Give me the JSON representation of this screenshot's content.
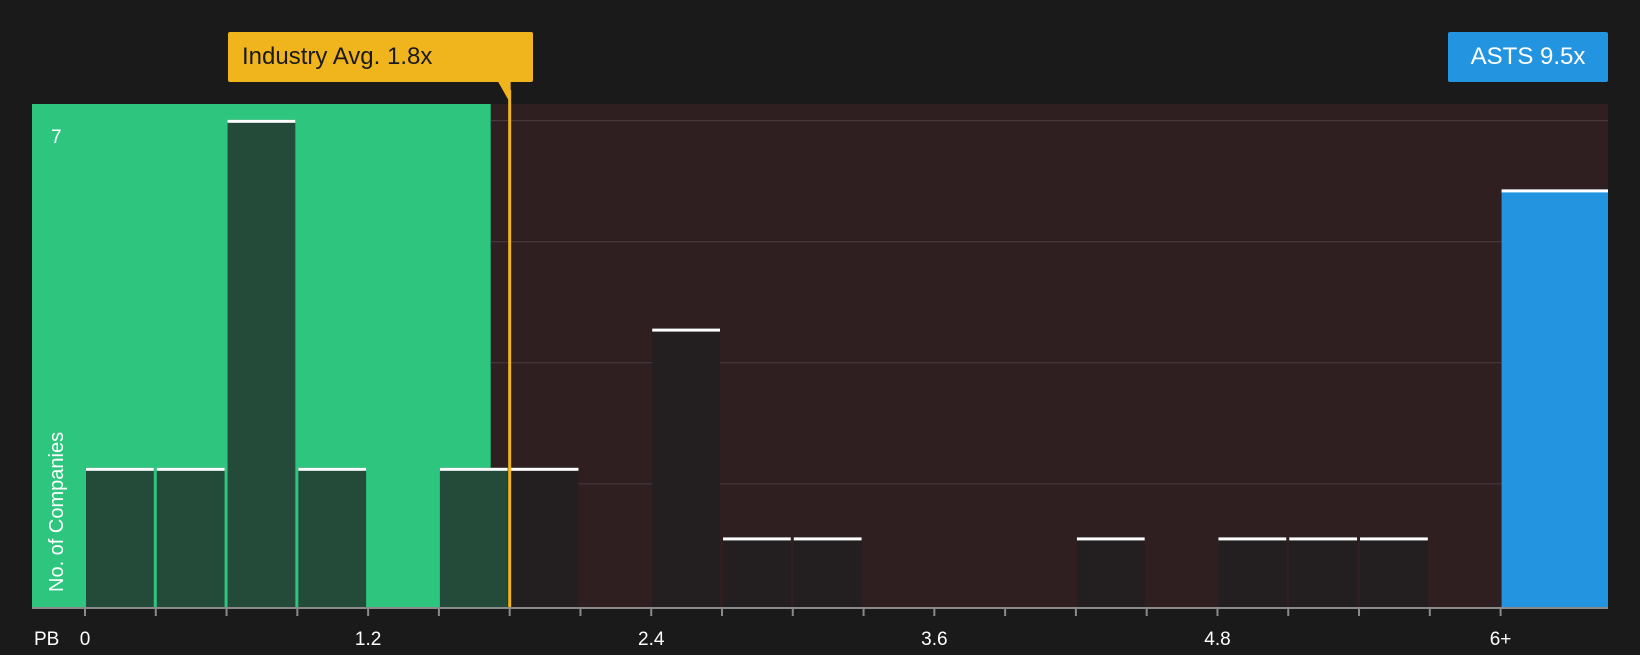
{
  "chart_data": {
    "type": "bar",
    "title": "",
    "xlabel": "PB",
    "ylabel": "No. of Companies",
    "xlim": [
      0,
      6.2
    ],
    "ylim": [
      0,
      7
    ],
    "bin_width": 0.3,
    "x_ticks": [
      {
        "value": 0,
        "label": "0"
      },
      {
        "value": 1.2,
        "label": "1.2"
      },
      {
        "value": 2.4,
        "label": "2.4"
      },
      {
        "value": 3.6,
        "label": "3.6"
      },
      {
        "value": 4.8,
        "label": "4.8"
      },
      {
        "value": 6.0,
        "label": "6+"
      }
    ],
    "y_ticks": [
      {
        "value": 7,
        "label": "7"
      }
    ],
    "bins": [
      {
        "start": 0.0,
        "count": 2
      },
      {
        "start": 0.3,
        "count": 2
      },
      {
        "start": 0.6,
        "count": 7
      },
      {
        "start": 0.9,
        "count": 2
      },
      {
        "start": 1.5,
        "count": 2
      },
      {
        "start": 1.8,
        "count": 2
      },
      {
        "start": 2.4,
        "count": 4
      },
      {
        "start": 2.7,
        "count": 1
      },
      {
        "start": 3.0,
        "count": 1
      },
      {
        "start": 4.2,
        "count": 1
      },
      {
        "start": 4.8,
        "count": 1
      },
      {
        "start": 5.1,
        "count": 1
      },
      {
        "start": 5.4,
        "count": 1
      }
    ],
    "highlight_bar": {
      "name": "ASTS",
      "value": 9.5,
      "count": 6
    },
    "industry_avg": {
      "value": 1.8
    },
    "fair_zone_end": 1.72,
    "annotations": {
      "industry_label": "Industry Avg. 1.8x",
      "company_label": "ASTS 9.5x"
    },
    "colors": {
      "background": "#1a1a1b",
      "good_zone": "#2ec67f",
      "bad_zone": "#2f1f20",
      "bar_in_good_zone": "#244a39",
      "bar_in_bad_zone": "#231f20",
      "bar_cap": "#ffffff",
      "industry": "#f0b41c",
      "company": "#2394e0",
      "grid": "#4a3f40",
      "text": "#ffffff"
    },
    "grid": true
  }
}
